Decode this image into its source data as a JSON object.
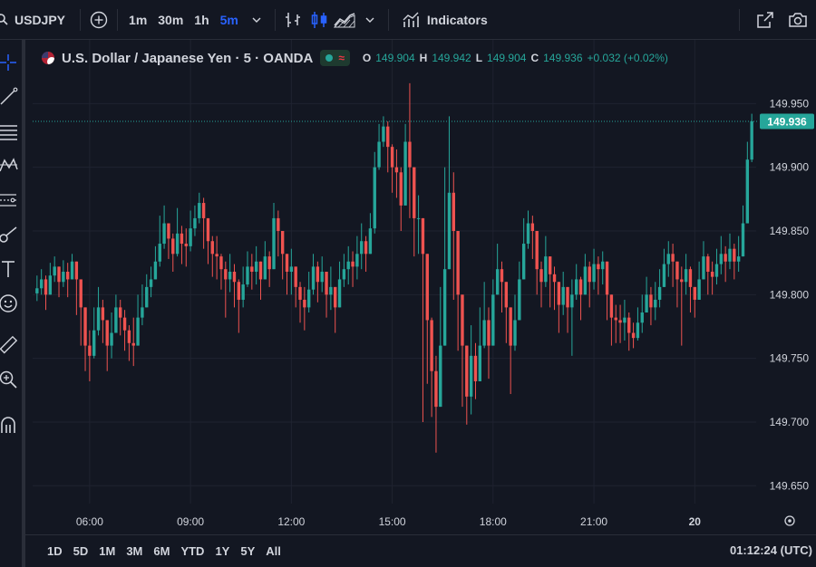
{
  "toolbar": {
    "symbol": "USDJPY",
    "intervals": [
      "1m",
      "30m",
      "1h",
      "5m"
    ],
    "active_interval": "5m",
    "indicators_label": "Indicators"
  },
  "legend": {
    "title": "U.S. Dollar / Japanese Yen · 5 · OANDA",
    "market_wave": "≈",
    "open_label": "O",
    "open": "149.904",
    "high_label": "H",
    "high": "149.942",
    "low_label": "L",
    "low": "149.904",
    "close_label": "C",
    "close": "149.936",
    "change": "+0.032 (+0.02%)"
  },
  "colors": {
    "background": "#131722",
    "up": "#26a69a",
    "down": "#ef5350",
    "accent": "#2962ff",
    "price_tag": "#26a69a"
  },
  "chart_data": {
    "type": "candlestick",
    "y_ticks": [
      149.65,
      149.7,
      149.75,
      149.8,
      149.85,
      149.9,
      149.95
    ],
    "y_tick_labels": [
      "149.650",
      "149.700",
      "149.750",
      "149.800",
      "149.850",
      "149.900",
      "149.950"
    ],
    "ylim": [
      149.636,
      150.0
    ],
    "x_ticks": [
      "06:00",
      "09:00",
      "12:00",
      "15:00",
      "18:00",
      "21:00",
      "20"
    ],
    "last_price": 149.936,
    "last_price_label": "149.936",
    "grid": true,
    "series_close": [
      149.805,
      149.812,
      149.8,
      149.815,
      149.822,
      149.81,
      149.818,
      149.812,
      149.826,
      149.812,
      149.79,
      149.76,
      149.752,
      149.772,
      149.79,
      149.78,
      149.76,
      149.77,
      149.79,
      149.782,
      149.772,
      149.762,
      149.76,
      149.782,
      149.79,
      149.806,
      149.812,
      149.826,
      149.84,
      149.856,
      149.844,
      149.832,
      149.848,
      149.84,
      149.838,
      149.852,
      149.86,
      149.872,
      149.86,
      149.842,
      149.832,
      149.83,
      149.82,
      149.812,
      149.818,
      149.81,
      149.796,
      149.808,
      149.822,
      149.818,
      149.826,
      149.812,
      149.83,
      149.82,
      149.86,
      149.85,
      149.832,
      149.818,
      149.822,
      149.806,
      149.796,
      149.79,
      149.804,
      149.822,
      149.81,
      149.818,
      149.8,
      149.806,
      149.79,
      149.812,
      149.82,
      149.826,
      149.822,
      149.832,
      149.842,
      149.832,
      149.852,
      149.9,
      149.92,
      149.932,
      149.916,
      149.9,
      149.896,
      149.87,
      149.92,
      149.9,
      149.86,
      149.86,
      149.832,
      149.78,
      149.74,
      149.712,
      149.76,
      149.82,
      149.88,
      149.85,
      149.8,
      149.76,
      149.72,
      149.752,
      149.732,
      149.76,
      149.78,
      149.76,
      149.8,
      149.82,
      149.81,
      149.79,
      149.76,
      149.78,
      149.812,
      149.84,
      149.856,
      149.85,
      149.82,
      149.81,
      149.83,
      149.816,
      149.81,
      149.792,
      149.806,
      149.79,
      149.8,
      149.812,
      149.8,
      149.822,
      149.81,
      149.824,
      149.82,
      149.826,
      149.8,
      149.782,
      149.78,
      149.778,
      149.782,
      149.77,
      149.766,
      149.778,
      149.786,
      149.8,
      149.79,
      149.796,
      149.806,
      149.824,
      149.832,
      149.826,
      149.812,
      149.81,
      149.82,
      149.806,
      149.796,
      149.812,
      149.83,
      149.818,
      149.814,
      149.824,
      149.832,
      149.826,
      149.836,
      149.826,
      149.83,
      149.856,
      149.906,
      149.936
    ],
    "series_high": [
      149.815,
      149.82,
      149.815,
      149.825,
      149.83,
      149.822,
      149.827,
      149.825,
      149.832,
      149.826,
      149.806,
      149.788,
      149.772,
      149.79,
      149.806,
      149.796,
      149.78,
      149.786,
      149.8,
      149.796,
      149.788,
      149.776,
      149.782,
      149.8,
      149.808,
      149.816,
      149.822,
      149.838,
      149.862,
      149.87,
      149.856,
      149.848,
      149.868,
      149.854,
      149.852,
      149.866,
      149.87,
      149.88,
      149.876,
      149.858,
      149.846,
      149.846,
      149.832,
      149.826,
      149.832,
      149.824,
      149.812,
      149.822,
      149.834,
      149.832,
      149.838,
      149.826,
      149.842,
      149.834,
      149.872,
      149.866,
      149.85,
      149.832,
      149.836,
      149.822,
      149.81,
      149.806,
      149.818,
      149.832,
      149.826,
      149.83,
      149.812,
      149.822,
      149.806,
      149.826,
      149.832,
      149.838,
      149.834,
      149.846,
      149.856,
      149.846,
      149.864,
      149.912,
      149.934,
      149.94,
      149.936,
      149.918,
      149.914,
      149.9,
      149.934,
      149.966,
      149.88,
      149.878,
      149.86,
      149.82,
      149.782,
      149.752,
      149.806,
      149.9,
      149.94,
      149.896,
      149.832,
      149.8,
      149.76,
      149.776,
      149.762,
      149.79,
      149.81,
      149.79,
      149.812,
      149.84,
      149.826,
      149.806,
      149.79,
      149.8,
      149.826,
      149.86,
      149.866,
      149.862,
      149.838,
      149.826,
      149.846,
      149.826,
      149.822,
      149.81,
      149.818,
      149.806,
      149.812,
      149.824,
      149.814,
      149.832,
      149.826,
      149.836,
      149.83,
      149.834,
      149.82,
      149.798,
      149.792,
      149.792,
      149.796,
      149.786,
      149.778,
      149.79,
      149.8,
      149.814,
      149.806,
      149.81,
      149.82,
      149.836,
      149.842,
      149.84,
      149.826,
      149.822,
      149.832,
      149.822,
      149.806,
      149.826,
      149.842,
      149.832,
      149.826,
      149.836,
      149.846,
      149.838,
      149.848,
      149.84,
      149.846,
      149.87,
      149.92,
      149.942
    ],
    "series_low": [
      149.795,
      149.8,
      149.788,
      149.804,
      149.81,
      149.798,
      149.806,
      149.798,
      149.812,
      149.784,
      149.76,
      149.74,
      149.732,
      149.75,
      149.768,
      149.762,
      149.74,
      149.75,
      149.774,
      149.768,
      149.756,
      149.748,
      149.744,
      149.76,
      149.776,
      149.79,
      149.798,
      149.812,
      149.822,
      149.836,
      149.828,
      149.818,
      149.83,
      149.824,
      149.822,
      149.834,
      149.846,
      149.856,
      149.836,
      149.824,
      149.814,
      149.812,
      149.804,
      149.782,
      149.802,
      149.79,
      149.77,
      149.79,
      149.806,
      149.804,
      149.808,
      149.796,
      149.812,
      149.806,
      149.828,
      149.83,
      149.812,
      149.8,
      149.8,
      149.79,
      149.778,
      149.772,
      149.786,
      149.8,
      149.794,
      149.802,
      149.782,
      149.788,
      149.77,
      149.792,
      149.806,
      149.808,
      149.806,
      149.812,
      149.82,
      149.818,
      149.832,
      149.848,
      149.898,
      149.916,
      149.896,
      149.88,
      149.876,
      149.85,
      149.88,
      149.86,
      149.83,
      149.832,
      149.7,
      149.73,
      149.704,
      149.676,
      149.72,
      149.76,
      149.838,
      149.796,
      149.756,
      149.712,
      149.698,
      149.706,
      149.718,
      149.736,
      149.758,
      149.734,
      149.766,
      149.802,
      149.786,
      149.762,
      149.722,
      149.756,
      149.788,
      149.812,
      149.836,
      149.828,
      149.8,
      149.79,
      149.806,
      149.79,
      149.788,
      149.77,
      149.784,
      149.77,
      149.752,
      149.796,
      149.78,
      149.806,
      149.79,
      149.804,
      149.8,
      149.808,
      149.78,
      149.76,
      149.762,
      149.762,
      149.764,
      149.756,
      149.758,
      149.764,
      149.77,
      149.786,
      149.776,
      149.78,
      149.79,
      149.806,
      149.814,
      149.806,
      149.79,
      149.76,
      149.8,
      149.786,
      149.782,
      149.796,
      149.812,
      149.8,
      149.8,
      149.808,
      149.816,
      149.81,
      149.82,
      149.812,
      149.818,
      149.84,
      149.856,
      149.904
    ]
  },
  "sidebar_tools": [
    "crosshair-icon",
    "trend-line-icon",
    "horizontal-lines-icon",
    "pattern-icon",
    "fib-icon",
    "brush-icon",
    "text-icon",
    "emoji-icon",
    "ruler-icon",
    "zoom-icon",
    "magnet-icon"
  ],
  "bottom": {
    "ranges": [
      "1D",
      "5D",
      "1M",
      "3M",
      "6M",
      "YTD",
      "1Y",
      "5Y",
      "All"
    ],
    "clock": "01:12:24 (UTC)"
  }
}
